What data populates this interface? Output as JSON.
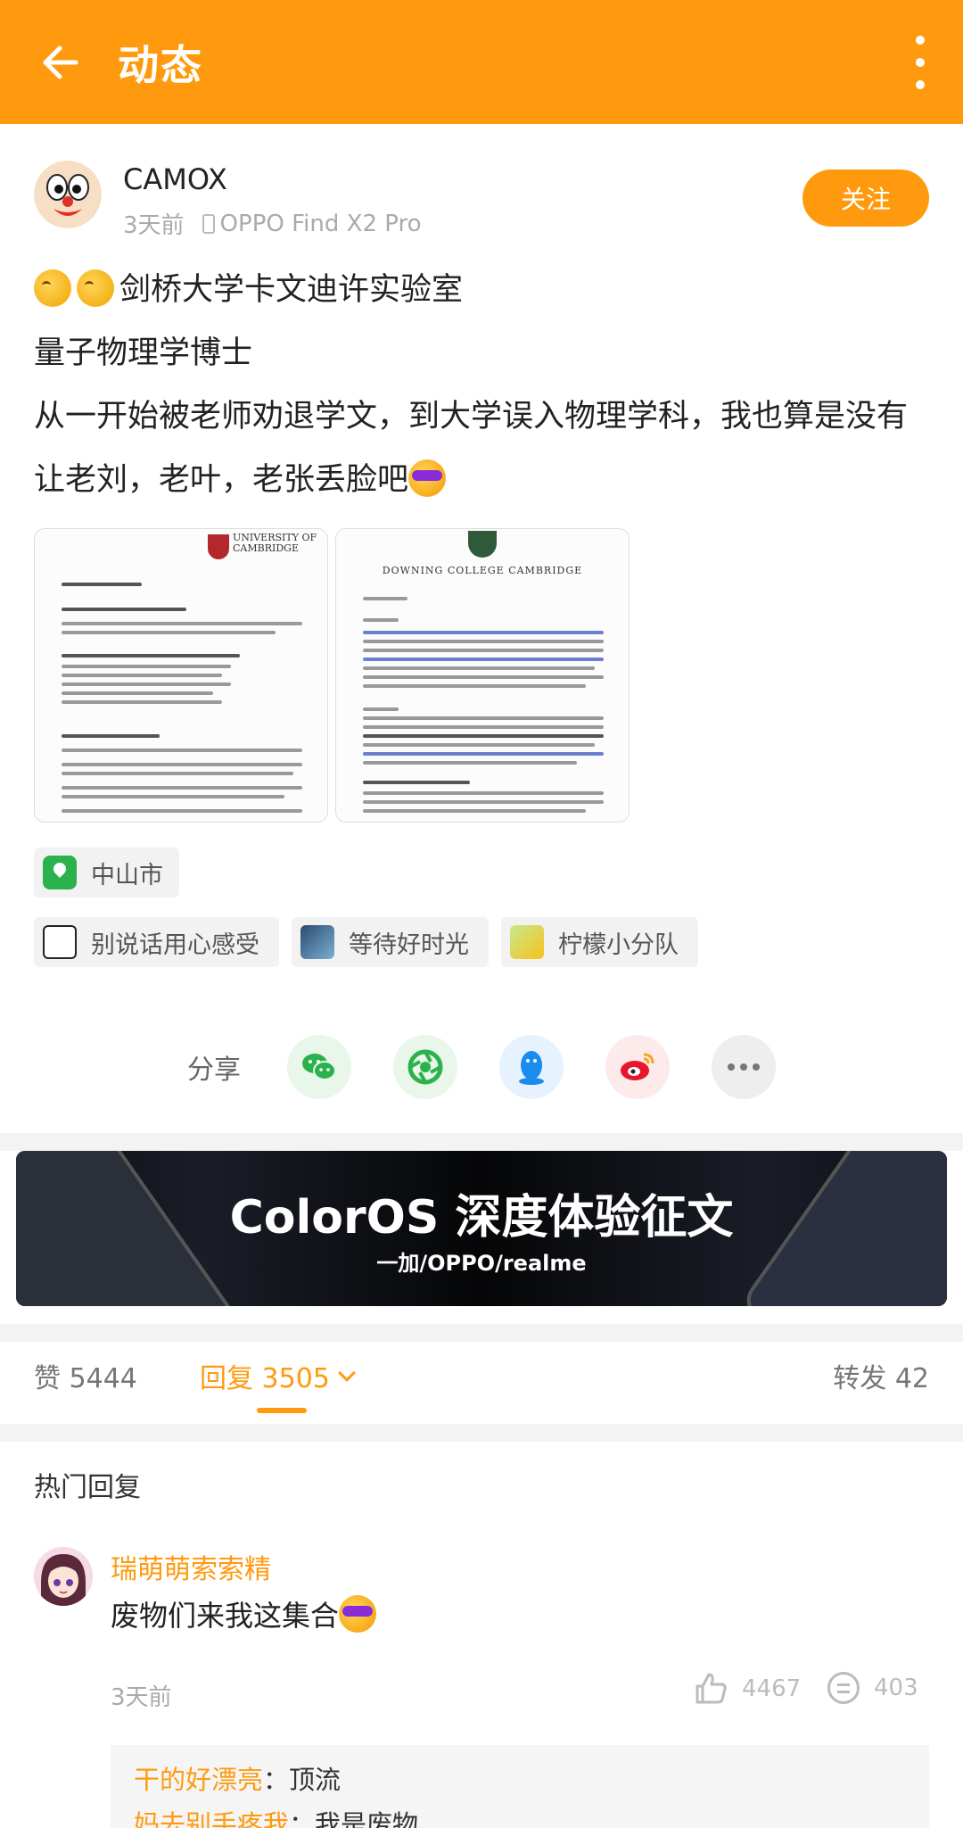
{
  "topbar": {
    "title": "动态"
  },
  "author": {
    "name": "CAMOX",
    "time": "3天前",
    "device": "OPPO Find X2 Pro",
    "follow_label": "关注"
  },
  "post": {
    "line1": "剑桥大学卡文迪许实验室",
    "line2": "量子物理学博士",
    "line3": "从一开始被老师劝退学文，到大学误入物理学科，我也算是没有让老刘，老叶，老张丢脸吧"
  },
  "images": {
    "doc1_header": "UNIVERSITY OF CAMBRIDGE",
    "doc2_header": "DOWNING COLLEGE CAMBRIDGE"
  },
  "location": "中山市",
  "tags": [
    "别说话用心感受",
    "等待好时光",
    "柠檬小分队"
  ],
  "share": {
    "label": "分享"
  },
  "banner": {
    "title": "ColorOS 深度体验征文",
    "subtitle": "一加/OPPO/realme"
  },
  "tabs": {
    "likes": "赞 5444",
    "replies": "回复 3505",
    "forwards": "转发 42"
  },
  "hot": {
    "title": "热门回复",
    "comment": {
      "name": "瑞萌萌索索精",
      "text": "废物们来我这集合",
      "time": "3天前",
      "likes": "4467",
      "replies": "403"
    },
    "subreplies": [
      {
        "name": "干的好漂亮",
        "text": "：顶流"
      },
      {
        "name": "妈去别手疼我",
        "text": "：我是废物"
      }
    ]
  },
  "colors": {
    "accent": "#ff9a0f"
  }
}
